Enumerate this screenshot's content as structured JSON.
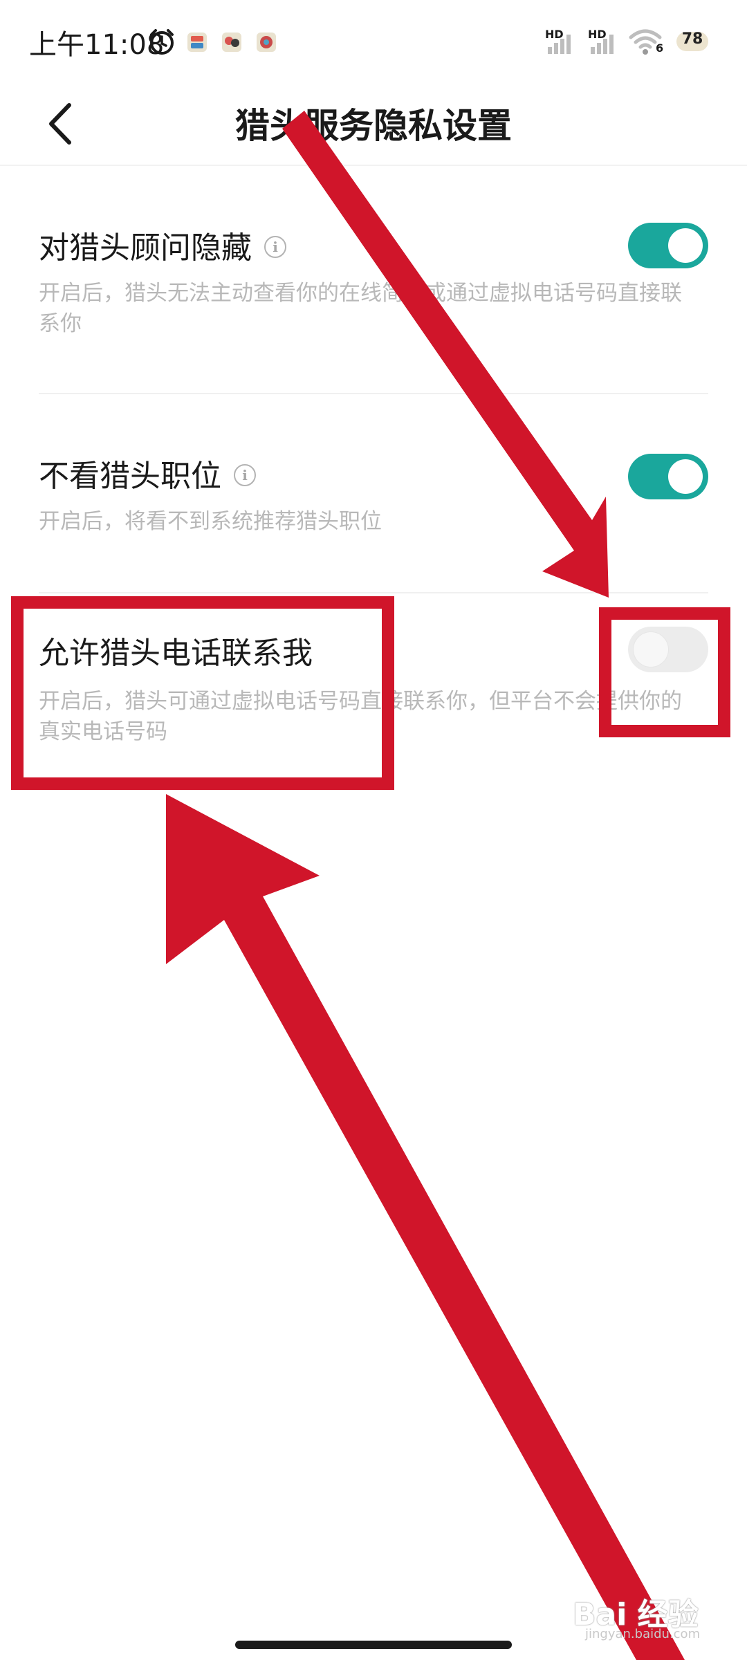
{
  "status_bar": {
    "time": "上午11:08",
    "network_1": "HD",
    "network_2": "HD",
    "wifi_label": "6",
    "battery": "78",
    "icons": [
      "alarm-icon",
      "notification-app-icon",
      "notification-app-icon",
      "notification-app-icon",
      "signal-icon",
      "signal-icon",
      "wifi-icon",
      "battery-icon"
    ]
  },
  "header": {
    "title": "猎头服务隐私设置",
    "back_icon": "chevron-left-icon"
  },
  "settings": [
    {
      "title": "对猎头顾问隐藏",
      "has_info": true,
      "description": "开启后，猎头无法主动查看你的在线简历或通过虚拟电话号码直接联系你",
      "enabled": true
    },
    {
      "title": "不看猎头职位",
      "has_info": true,
      "description": "开启后，将看不到系统推荐猎头职位",
      "enabled": true
    },
    {
      "title": "允许猎头电话联系我",
      "has_info": false,
      "description": "开启后，猎头可通过虚拟电话号码直接联系你，但平台不会提供你的真实电话号码",
      "enabled": false
    }
  ],
  "colors": {
    "toggle_on": "#1aa79c",
    "toggle_off": "#ececec",
    "annotation_red": "#d0152a"
  },
  "watermark": {
    "brand": "Bai 经验",
    "url": "jingyan.baidu.com"
  }
}
